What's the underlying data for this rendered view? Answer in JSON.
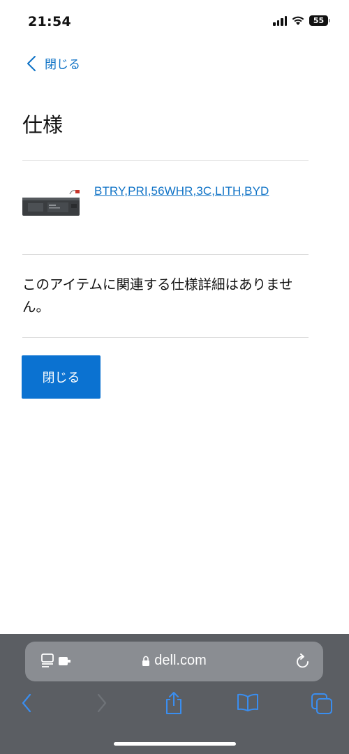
{
  "status_bar": {
    "time": "21:54",
    "battery": "55"
  },
  "nav": {
    "back_label": "閉じる"
  },
  "page": {
    "title": "仕様",
    "product": {
      "name": "BTRY,PRI,56WHR,3C,LITH,BYD",
      "image": "battery-pack-image"
    },
    "message": "このアイテムに関連する仕様詳細はありません。",
    "close_button": "閉じる"
  },
  "browser": {
    "url": "dell.com",
    "icons": [
      "page-menu-icon",
      "lock-icon",
      "reload-icon",
      "back-icon",
      "forward-icon",
      "share-icon",
      "bookmarks-icon",
      "tabs-icon"
    ]
  }
}
